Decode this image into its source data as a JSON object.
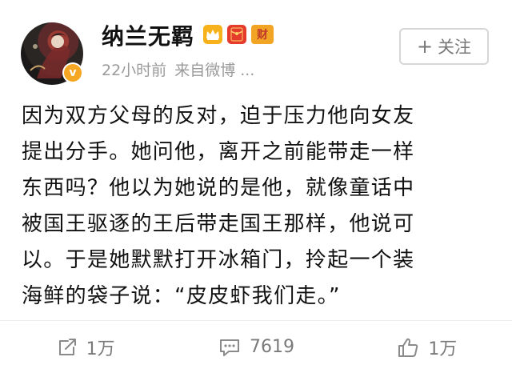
{
  "post": {
    "username": "纳兰无羁",
    "time": "22小时前",
    "source": "来自微博 ...",
    "follow_label": "关注",
    "follow_plus": "+",
    "badges": {
      "cai_label": "财"
    },
    "verified_mark": "v",
    "content_lines": [
      "因为双方父母的反对，迫于压力他向女友",
      "提出分手。她问他，离开之前能带走一样",
      "东西吗？他以为她说的是他，就像童话中",
      "被国王驱逐的王后带走国王那样，他说可",
      "以。于是她默默打开冰箱门，拎起一个装",
      "海鲜的袋子说：“皮皮虾我们走。”"
    ]
  },
  "actions": {
    "repost_count": "1万",
    "comment_count": "7619",
    "like_count": "1万"
  },
  "colors": {
    "meta_gray": "#9a9a9a",
    "action_gray": "#7a7a7a",
    "badge_gold": "#f7b21b",
    "badge_red": "#e53b2c",
    "verified_orange": "#f5a623"
  }
}
